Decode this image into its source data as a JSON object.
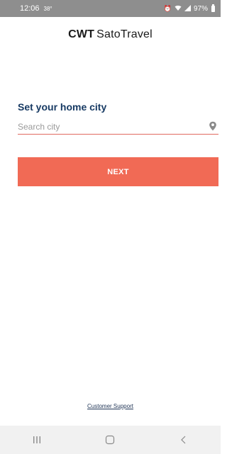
{
  "status_bar": {
    "time": "12:06",
    "temperature": "38°",
    "battery": "97%",
    "icons": [
      "alarm-icon",
      "wifi-icon",
      "signal-icon",
      "battery-icon"
    ]
  },
  "header": {
    "brand_bold": "CWT",
    "brand_light": "SatoTravel"
  },
  "main": {
    "heading": "Set your home city",
    "search": {
      "placeholder": "Search city",
      "value": "",
      "icon": "location-pin-icon"
    },
    "next_label": "NEXT"
  },
  "footer": {
    "support_link": "Customer Support"
  },
  "nav_bar": {
    "buttons": [
      "recent-apps-icon",
      "home-icon",
      "back-icon"
    ]
  },
  "colors": {
    "accent": "#f16a55",
    "heading": "#173a63",
    "status_bar": "#8e8e8e"
  }
}
